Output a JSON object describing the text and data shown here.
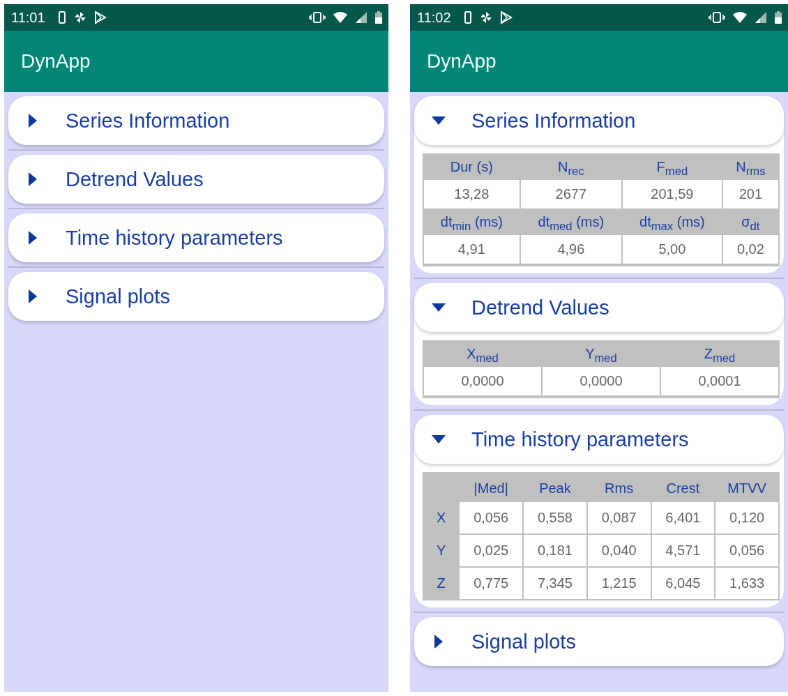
{
  "screens": [
    {
      "status_bar": {
        "time": "11:01"
      },
      "app_bar": {
        "title": "DynApp"
      },
      "sections": [
        {
          "title": "Series Information",
          "expanded": false
        },
        {
          "title": "Detrend Values",
          "expanded": false
        },
        {
          "title": "Time history parameters",
          "expanded": false
        },
        {
          "title": "Signal plots",
          "expanded": false
        }
      ]
    },
    {
      "status_bar": {
        "time": "11:02"
      },
      "app_bar": {
        "title": "DynApp"
      },
      "sections": [
        {
          "title": "Series Information",
          "expanded": true,
          "table": {
            "kind": "stacked",
            "rows": [
              {
                "kind": "header",
                "cells": [
                  "Dur (s)",
                  "N$_{rec}$",
                  "F$_{med}$",
                  "N$_{rms}$"
                ]
              },
              {
                "kind": "values",
                "cells": [
                  "13,28",
                  "2677",
                  "201,59",
                  "201"
                ]
              },
              {
                "kind": "header",
                "cells": [
                  "dt$_{min}$ (ms)",
                  "dt$_{med}$ (ms)",
                  "dt$_{max}$ (ms)",
                  "σ$_{dt}$"
                ]
              },
              {
                "kind": "values",
                "cells": [
                  "4,91",
                  "4,96",
                  "5,00",
                  "0,02"
                ]
              }
            ]
          }
        },
        {
          "title": "Detrend Values",
          "expanded": true,
          "table": {
            "kind": "stacked",
            "rows": [
              {
                "kind": "header",
                "cells": [
                  "X$_{med}$",
                  "Y$_{med}$",
                  "Z$_{med}$"
                ]
              },
              {
                "kind": "values",
                "cells": [
                  "0,0000",
                  "0,0000",
                  "0,0001"
                ]
              }
            ]
          }
        },
        {
          "title": "Time history parameters",
          "expanded": true,
          "table": {
            "kind": "matrix",
            "columns": [
              "|Med|",
              "Peak",
              "Rms",
              "Crest",
              "MTVV"
            ],
            "rows": [
              {
                "label": "X",
                "values": [
                  "0,056",
                  "0,558",
                  "0,087",
                  "6,401",
                  "0,120"
                ]
              },
              {
                "label": "Y",
                "values": [
                  "0,025",
                  "0,181",
                  "0,040",
                  "4,571",
                  "0,056"
                ]
              },
              {
                "label": "Z",
                "values": [
                  "0,775",
                  "7,345",
                  "1,215",
                  "6,045",
                  "1,633"
                ]
              }
            ]
          }
        },
        {
          "title": "Signal plots",
          "expanded": false
        }
      ]
    }
  ]
}
